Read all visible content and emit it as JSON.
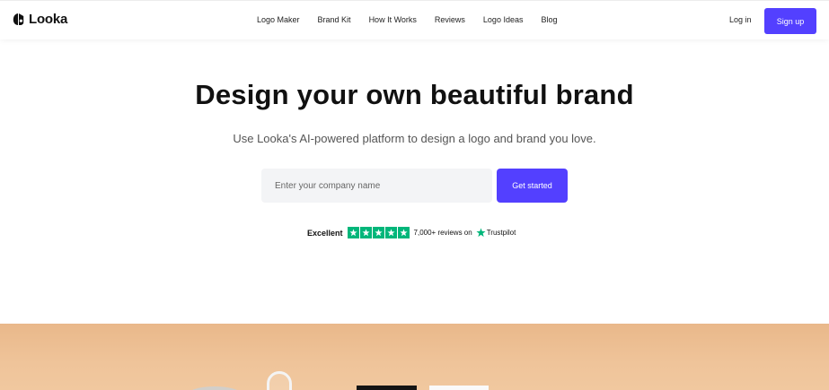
{
  "header": {
    "brand": {
      "name": "Looka",
      "icon": "looka-logo-icon"
    },
    "nav_links": [
      "Logo Maker",
      "Brand Kit",
      "How It Works",
      "Reviews",
      "Logo Ideas",
      "Blog"
    ],
    "login_label": "Log in",
    "signup_label": "Sign up"
  },
  "hero": {
    "title": "Design your own beautiful brand",
    "subtitle": "Use Looka's AI-powered platform to design a logo and brand you love.",
    "company_input": {
      "placeholder": "Enter your company name",
      "value": ""
    },
    "cta_label": "Get started",
    "rating": {
      "label": "Excellent",
      "stars": 5,
      "reviews_text": "7,000+ reviews on",
      "provider": "Trustpilot"
    }
  },
  "colors": {
    "accent": "#5340ff",
    "trustpilot_green": "#00b67a",
    "hero_image_background": "#efc49a",
    "input_background": "#f3f4f6"
  }
}
